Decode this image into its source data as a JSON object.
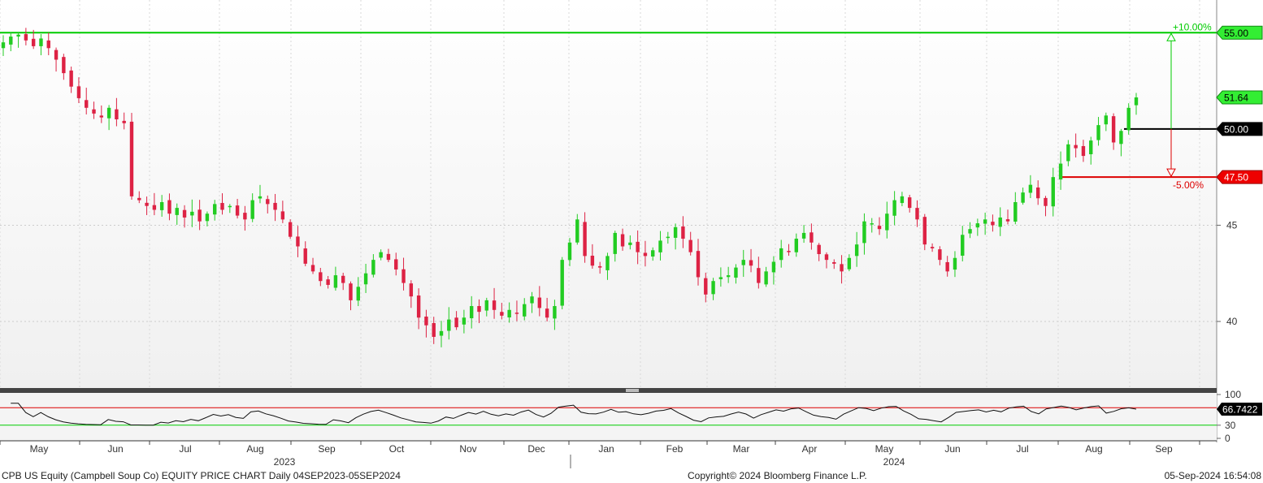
{
  "footer": {
    "left": "CPB US Equity (Campbell Soup Co) EQUITY PRICE CHART  Daily 04SEP2023-05SEP2024",
    "center": "Copyright© 2024 Bloomberg Finance L.P.",
    "right": "05-Sep-2024 16:54:08"
  },
  "colors": {
    "up": "#22cc22",
    "down": "#dd2244",
    "target_line": "#00cc00",
    "stop_line": "#dd0000",
    "reference_line": "#000000"
  },
  "chart_data": [
    {
      "type": "candlestick",
      "title": "",
      "x_tick_labels": [
        "May",
        "Jun",
        "Jul",
        "Aug",
        "Sep",
        "Oct",
        "Nov",
        "Dec",
        "Jan",
        "Feb",
        "Mar",
        "Apr",
        "May",
        "Jun",
        "Jul",
        "Aug",
        "Sep"
      ],
      "year_labels": [
        "2023",
        "2024"
      ],
      "y_ticks": [
        40,
        45
      ],
      "ylim": [
        36.5,
        56.7
      ],
      "grid": true,
      "price_tags": [
        {
          "label": "55.00",
          "value": 55.0,
          "style": "target"
        },
        {
          "label": "51.64",
          "value": 51.64,
          "style": "last"
        },
        {
          "label": "50.00",
          "value": 50.0,
          "style": "reference"
        },
        {
          "label": "47.50",
          "value": 47.5,
          "style": "stop"
        }
      ],
      "annotations": [
        {
          "label": "+10.00%",
          "value": 55.0
        },
        {
          "label": "-5.00%",
          "value": 47.5
        }
      ],
      "closes_sampled": [
        54.5,
        54.8,
        54.9,
        54.6,
        54.3,
        54.7,
        54.2,
        53.6,
        52.9,
        52.2,
        51.6,
        51.1,
        50.8,
        50.6,
        51.1,
        50.5,
        50.3,
        46.5,
        46.3,
        46.0,
        45.8,
        46.2,
        45.6,
        45.9,
        45.4,
        45.7,
        45.2,
        45.6,
        46.1,
        45.8,
        46.0,
        45.5,
        45.3,
        46.3,
        46.5,
        46.1,
        45.8,
        45.3,
        44.4,
        43.9,
        43.0,
        42.6,
        42.1,
        41.9,
        42.4,
        42.0,
        41.1,
        41.8,
        42.5,
        43.2,
        43.6,
        43.2,
        42.7,
        42.0,
        41.3,
        40.2,
        39.8,
        39.2,
        39.5,
        40.1,
        39.7,
        40.2,
        40.8,
        40.5,
        41.1,
        40.6,
        40.3,
        40.6,
        40.4,
        40.9,
        41.3,
        40.7,
        40.2,
        40.8,
        43.2,
        44.1,
        45.3,
        43.4,
        42.9,
        42.8,
        43.4,
        44.6,
        43.9,
        44.1,
        43.6,
        43.4,
        43.7,
        44.2,
        44.4,
        44.9,
        44.3,
        43.6,
        42.3,
        41.4,
        42.1,
        42.3,
        42.4,
        42.8,
        43.2,
        42.9,
        42.0,
        42.6,
        43.1,
        43.8,
        43.6,
        44.3,
        44.6,
        44.1,
        43.5,
        43.2,
        43.0,
        42.6,
        43.3,
        44.0,
        45.2,
        45.1,
        44.8,
        45.6,
        46.3,
        46.5,
        45.9,
        45.3,
        44.0,
        43.8,
        43.2,
        42.6,
        43.3,
        44.5,
        44.8,
        45.1,
        45.3,
        45.0,
        45.4,
        45.2,
        46.2,
        46.7,
        47.1,
        46.4,
        46.0,
        47.5,
        48.2,
        49.2,
        49.0,
        48.6,
        49.4,
        50.2,
        50.7,
        49.3,
        49.9,
        51.1,
        51.64
      ]
    },
    {
      "type": "line",
      "title": "",
      "y_ticks": [
        0,
        30,
        100
      ],
      "ylim": [
        0,
        100
      ],
      "price_tags": [
        {
          "label": "66.7422",
          "value": 66.7422
        }
      ],
      "overbought": 70,
      "oversold": 30
    }
  ]
}
